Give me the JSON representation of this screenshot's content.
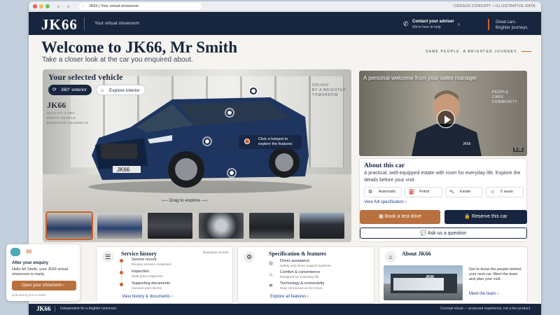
{
  "browser": {
    "url": "JK66 | Your virtual showroom",
    "right_label": "CERSUS CONCEPT • ILLUSTRATIVE DATA"
  },
  "header": {
    "logo": "JK66",
    "subtitle": "Your virtual showroom",
    "adviser_title": "Contact your adviser",
    "adviser_sub": "We're here to help",
    "tagline_1": "Great cars.",
    "tagline_2": "Brighter journeys."
  },
  "welcome": {
    "title": "Welcome to JK66, Mr Smith",
    "subtitle": "Take a closer look at the car you enquired about.",
    "side_tag": "SAME PEOPLE. A BRIGHTER JOURNEY."
  },
  "vehicle": {
    "heading": "Your selected vehicle",
    "toggle_exterior": "360° exterior",
    "toggle_interior": "Explore interior",
    "sign_logo": "JK66",
    "sign_lines": [
      "QUALITY CARS",
      "GREAT PEOPLE",
      "BRIGHTER JOURNEYS"
    ],
    "wall_text": [
      "DRIVEN",
      "BY A BRIGHTER",
      "TOMORROW"
    ],
    "plate": "JK66",
    "hint": "Click a hotspot to explore the features",
    "drag": "Drag to explore"
  },
  "video": {
    "caption": "A personal welcome from your sales manager",
    "wall_text": [
      "PEOPLE",
      "CARS",
      "COMMUNITY"
    ],
    "shirt_logo": "JK66",
    "duration": "1:12"
  },
  "about_car": {
    "title": "About this car",
    "description": "A practical, well-equipped estate with room for everyday life. Explore the details before your visit.",
    "specs": [
      {
        "icon": "gear-icon",
        "label": "Automatic"
      },
      {
        "icon": "fuel-icon",
        "label": "Petrol"
      },
      {
        "icon": "car-icon",
        "label": "Estate"
      },
      {
        "icon": "seats-icon",
        "label": "5 seats"
      }
    ],
    "specs_link": "View full specification",
    "test_drive": "Book a test drive",
    "reserve": "Reserve this car",
    "question": "Ask us a question"
  },
  "service": {
    "title": "Service history",
    "note": "Illustrative records",
    "items": [
      {
        "label": "Service record",
        "meta": "Routine service completed"
      },
      {
        "label": "Inspection",
        "meta": "Multi-point inspection"
      },
      {
        "label": "Supporting documents",
        "meta": "Invoices and checks"
      }
    ],
    "link": "View history & documents"
  },
  "features": {
    "title": "Specification & features",
    "items": [
      {
        "label": "Driver assistance",
        "meta": "Safety and driver support systems"
      },
      {
        "label": "Comfort & convenience",
        "meta": "Designed for everyday life"
      },
      {
        "label": "Technology & connectivity",
        "meta": "Stay connected on the move"
      }
    ],
    "link": "Explore all features"
  },
  "about_jk": {
    "title": "About JK66",
    "building_sign": "JK66",
    "text": "Get to know the people behind your next car. Meet the team and plan your visit.",
    "link": "Meet the team"
  },
  "enquiry": {
    "title": "After your enquiry",
    "text": "Hello Mr Smith, your JK66 virtual showroom is ready.",
    "button": "Open your showroom",
    "note": "Link sent by text or email"
  },
  "footer": {
    "logo": "JK66",
    "tagline": "Independent for a brighter tomorrow.",
    "right": "Concept visual — proposed experience, not a live product"
  },
  "colors": {
    "navy": "#17253f",
    "accent": "#c9612b",
    "button_brown": "#b8703e"
  }
}
